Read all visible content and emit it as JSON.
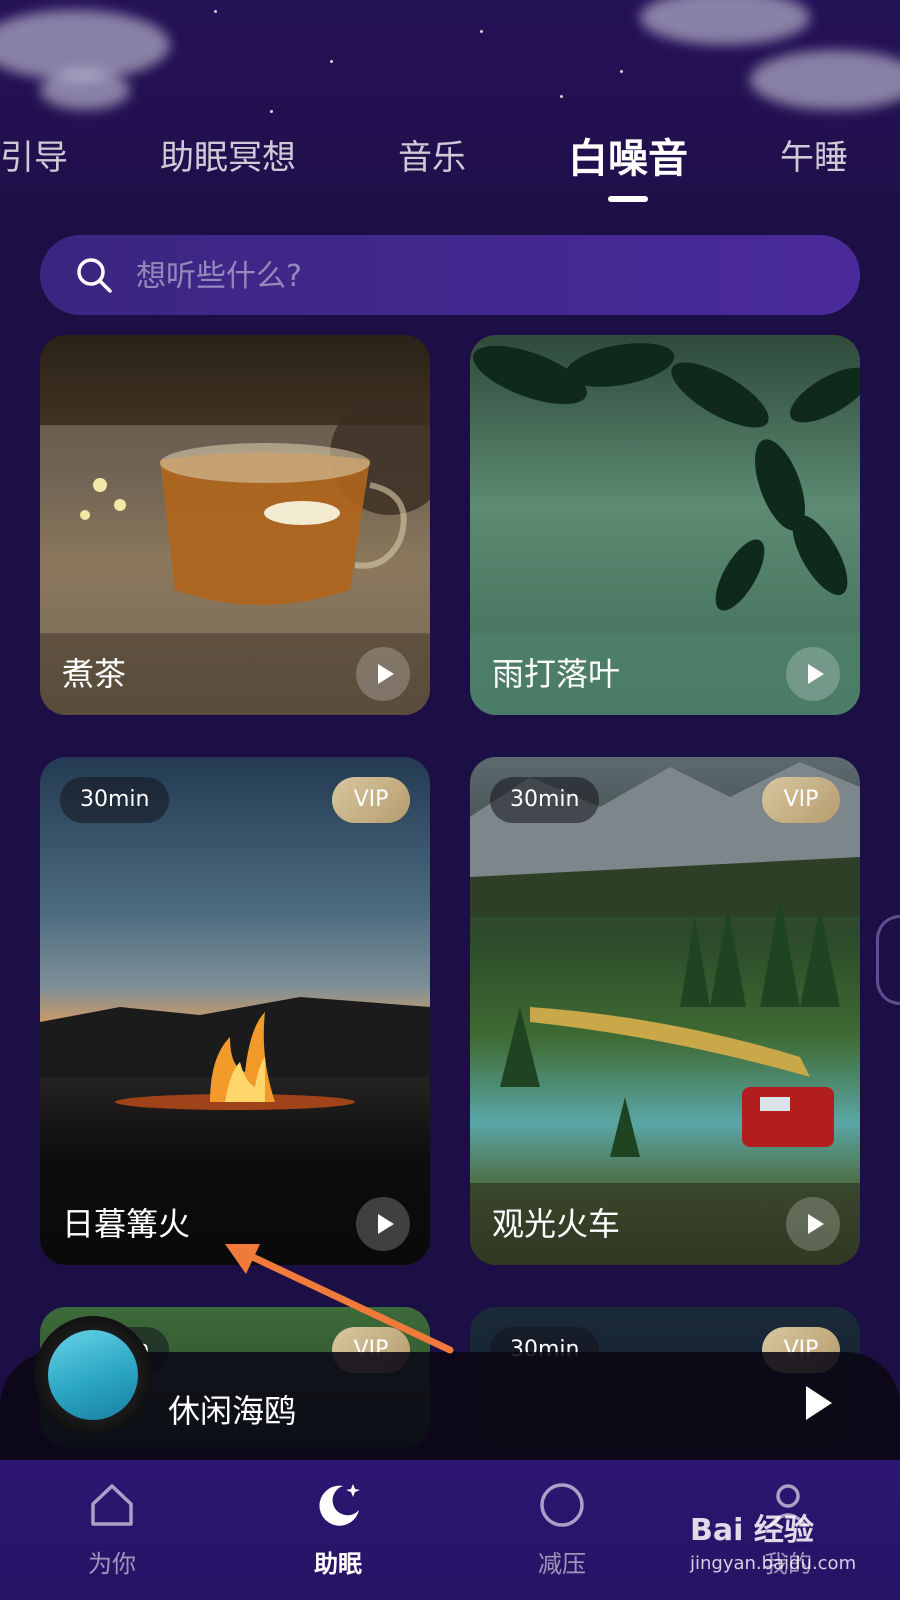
{
  "tabs": [
    {
      "label": "引导"
    },
    {
      "label": "助眠冥想"
    },
    {
      "label": "音乐"
    },
    {
      "label": "白噪音"
    },
    {
      "label": "午睡"
    }
  ],
  "active_tab": "白噪音",
  "search": {
    "placeholder": "想听些什么?"
  },
  "cards": [
    {
      "title": "煮茶"
    },
    {
      "title": "雨打落叶"
    },
    {
      "title": "日暮篝火",
      "duration": "30min",
      "badge": "VIP"
    },
    {
      "title": "观光火车",
      "duration": "30min",
      "badge": "VIP"
    },
    {
      "duration": "30min",
      "badge": "VIP"
    },
    {
      "duration": "30min",
      "badge": "VIP"
    }
  ],
  "player": {
    "track_title": "休闲海鸥",
    "state": "paused"
  },
  "bottom_nav": [
    {
      "label": "为你",
      "icon": "home-icon"
    },
    {
      "label": "助眠",
      "icon": "moon-icon"
    },
    {
      "label": "减压",
      "icon": "circle-icon"
    },
    {
      "label": "我的",
      "icon": "profile-icon"
    }
  ],
  "active_nav": "助眠",
  "watermark": {
    "brand": "Bai 经验",
    "url": "jingyan.baidu.com"
  },
  "colors": {
    "background": "#1c0f45",
    "nav_bg": "#2c1673",
    "vip_gold": "#c8b185",
    "annotation_arrow": "#f07a3a"
  }
}
